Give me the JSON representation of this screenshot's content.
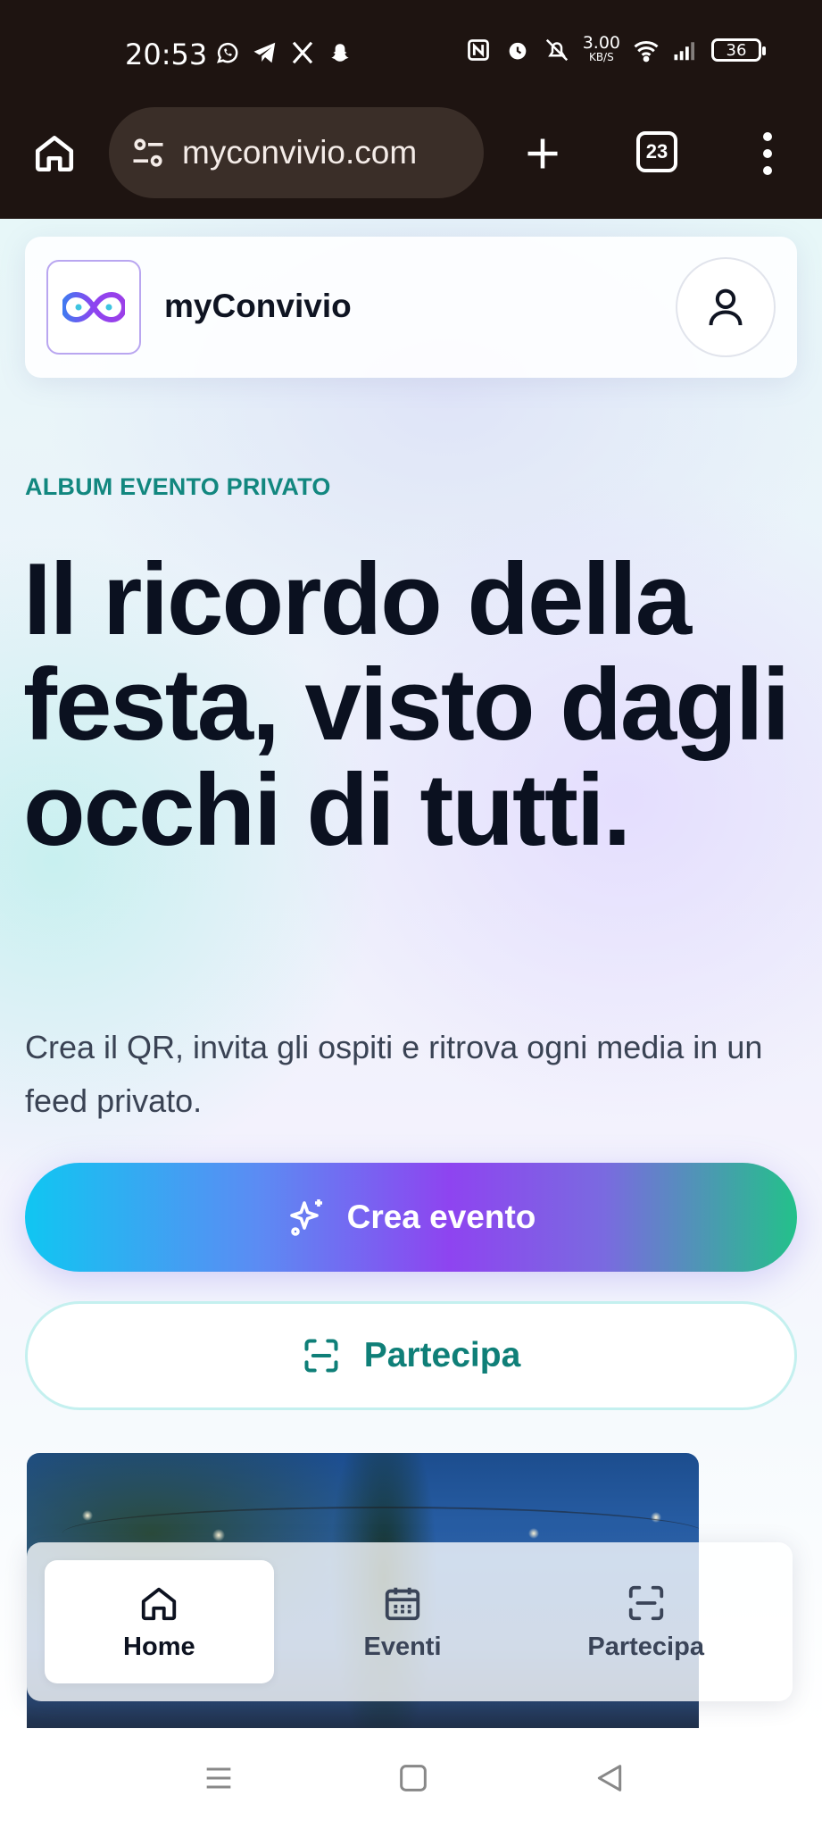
{
  "status_bar": {
    "time": "20:53",
    "left_icons": [
      "whatsapp-icon",
      "telegram-icon",
      "x-icon",
      "snapchat-icon"
    ],
    "net_speed_value": "3.00",
    "net_speed_unit": "KB/S",
    "battery": "36"
  },
  "browser": {
    "url": "myconvivio.com",
    "tab_count": "23"
  },
  "header": {
    "brand": "myConvivio"
  },
  "hero": {
    "eyebrow": "ALBUM EVENTO PRIVATO",
    "title": "Il ricordo della festa, visto dagli occhi di tutti.",
    "subtitle": "Crea il QR, invita gli ospiti e ritrova ogni media in un feed privato."
  },
  "actions": {
    "primary_label": "Crea evento",
    "secondary_label": "Partecipa"
  },
  "bottom_nav": {
    "items": [
      {
        "label": "Home",
        "icon": "home-icon",
        "active": true
      },
      {
        "label": "Eventi",
        "icon": "calendar-icon",
        "active": false
      },
      {
        "label": "Partecipa",
        "icon": "scan-icon",
        "active": false
      }
    ]
  },
  "colors": {
    "accent_teal": "#12877f",
    "chrome_bg": "#1e1411",
    "gradient_start": "#10c6f2",
    "gradient_mid": "#8e44f0",
    "gradient_end": "#23c18a"
  }
}
